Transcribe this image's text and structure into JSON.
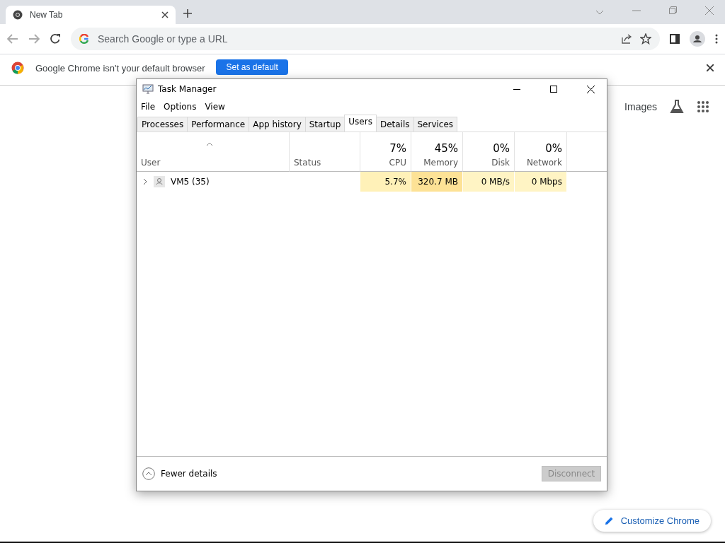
{
  "browser": {
    "tabs": [
      {
        "title": "New Tab",
        "selected": true
      }
    ],
    "omnibox": {
      "placeholder": "Search Google or type a URL"
    },
    "infobar": {
      "message": "Google Chrome isn't your default browser",
      "button": "Set as default"
    },
    "ntp": {
      "links": [
        "Images"
      ],
      "customize": "Customize Chrome"
    }
  },
  "task_manager": {
    "title": "Task Manager",
    "menu": [
      "File",
      "Options",
      "View"
    ],
    "tabs": [
      {
        "label": "Processes",
        "selected": false
      },
      {
        "label": "Performance",
        "selected": false
      },
      {
        "label": "App history",
        "selected": false
      },
      {
        "label": "Startup",
        "selected": false
      },
      {
        "label": "Users",
        "selected": true
      },
      {
        "label": "Details",
        "selected": false
      },
      {
        "label": "Services",
        "selected": false
      }
    ],
    "columns": [
      {
        "label": "User",
        "kind": "text"
      },
      {
        "label": "Status",
        "kind": "text"
      },
      {
        "label": "CPU",
        "total": "7%",
        "kind": "metric"
      },
      {
        "label": "Memory",
        "total": "45%",
        "kind": "metric"
      },
      {
        "label": "Disk",
        "total": "0%",
        "kind": "metric"
      },
      {
        "label": "Network",
        "total": "0%",
        "kind": "metric"
      }
    ],
    "rows": [
      {
        "expanded": false,
        "cells": [
          {
            "value": "VM5 (35)"
          },
          {},
          {
            "value": "5.7%",
            "color": "#fff1b8"
          },
          {
            "value": "320.7 MB",
            "color": "#fde296"
          },
          {
            "value": "0 MB/s",
            "color": "#fff4c4"
          },
          {
            "value": "0 Mbps",
            "color": "#fff4c4"
          }
        ]
      }
    ],
    "footer": {
      "toggle": "Fewer details",
      "button": "Disconnect",
      "button_disabled": true
    }
  }
}
